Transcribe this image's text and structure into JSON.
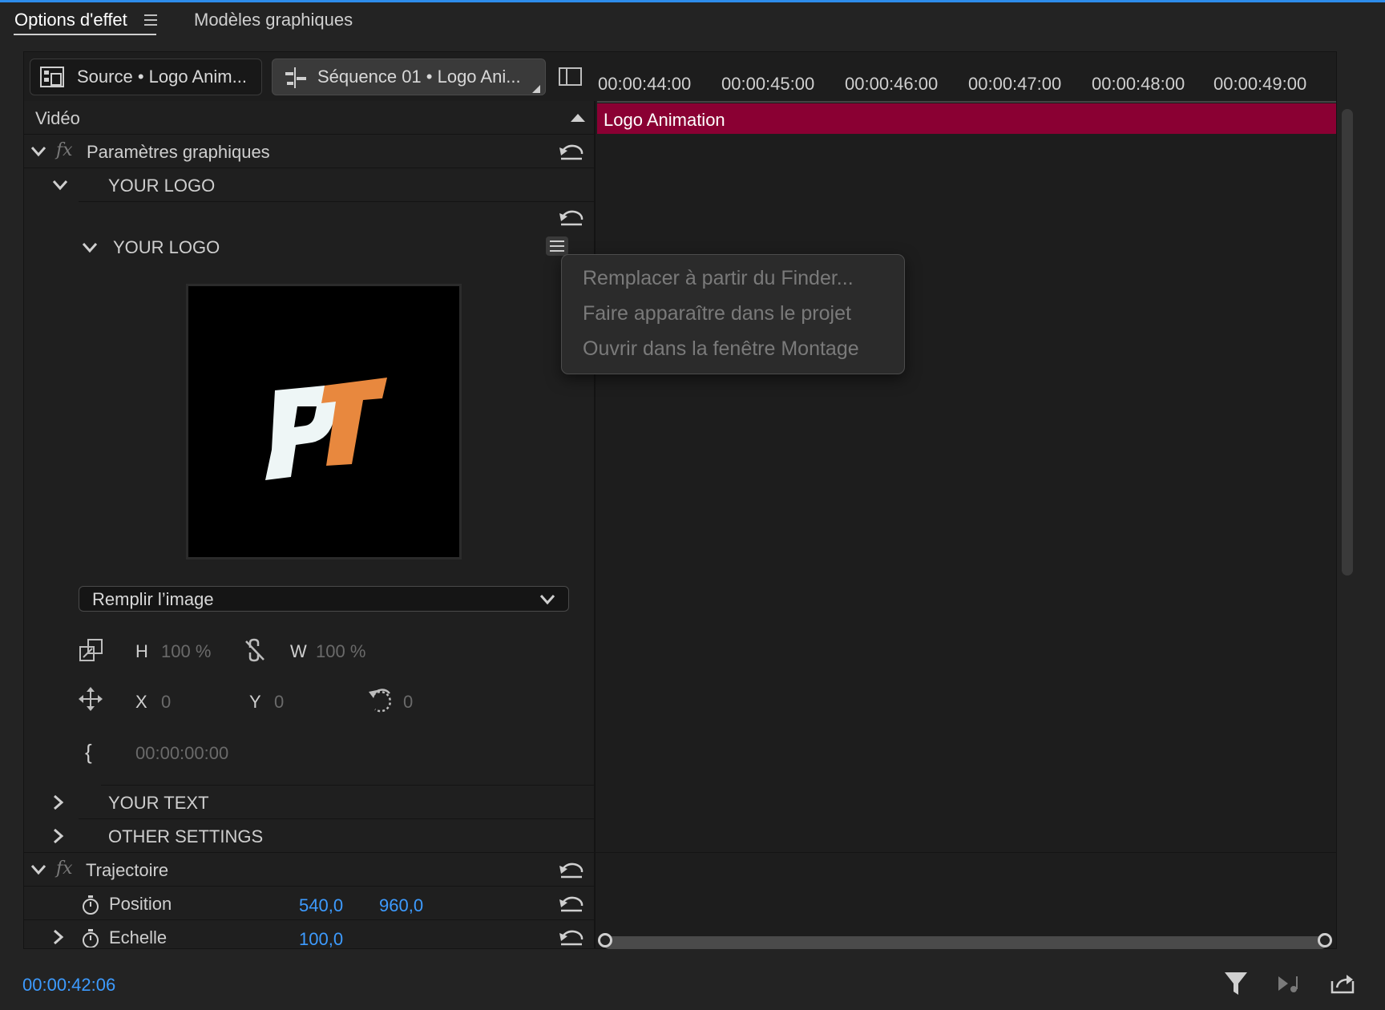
{
  "tabs": [
    {
      "label": "Options d'effet",
      "active": true
    },
    {
      "label": "Modèles graphiques",
      "active": false
    }
  ],
  "source_tabs": {
    "source_label": "Source • Logo Anim...",
    "sequence_label": "Séquence 01 • Logo Ani..."
  },
  "effects": {
    "section_label": "Vidéo",
    "graphics_params": "Paramètres graphiques",
    "group_your_logo": "YOUR LOGO",
    "subgroup_your_logo": "YOUR LOGO",
    "fill_dropdown": "Remplir l’image",
    "h_label": "H",
    "h_value": "100 %",
    "w_label": "W",
    "w_value": "100 %",
    "x_label": "X",
    "x_value": "0",
    "y_label": "Y",
    "y_value": "0",
    "rotation_value": "0",
    "time_value": "00:00:00:00",
    "group_your_text": "YOUR TEXT",
    "group_other_settings": "OTHER SETTINGS",
    "motion_label": "Trajectoire",
    "position_label": "Position",
    "position_x": "540,0",
    "position_y": "960,0",
    "scale_label": "Echelle",
    "scale_value": "100,0"
  },
  "timeline": {
    "ticks": [
      "00:00:44:00",
      "00:00:45:00",
      "00:00:46:00",
      "00:00:47:00",
      "00:00:48:00",
      "00:00:49:00"
    ],
    "clip_label": "Logo Animation"
  },
  "context_menu": {
    "items": [
      "Remplacer à partir du Finder...",
      "Faire apparaître dans le projet",
      "Ouvrir dans la fenêtre Montage"
    ]
  },
  "footer": {
    "timecode": "00:00:42:06"
  },
  "colors": {
    "accent_blue": "#3d9bff",
    "clip_color": "#8a0033",
    "logo_white": "#eef6f6",
    "logo_orange": "#e8883e"
  }
}
